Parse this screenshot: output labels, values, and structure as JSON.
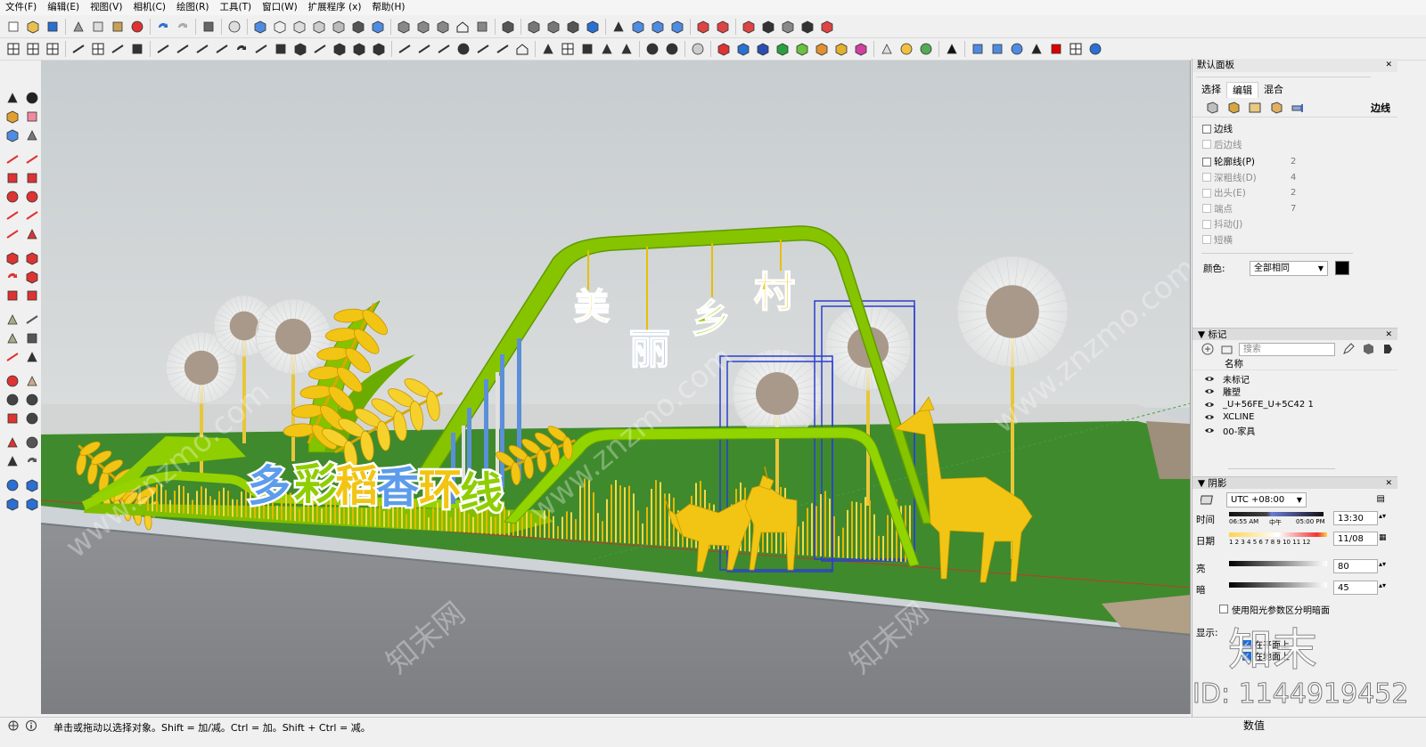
{
  "menu": [
    "文件(F)",
    "编辑(E)",
    "视图(V)",
    "相机(C)",
    "绘图(R)",
    "工具(T)",
    "窗口(W)",
    "扩展程序 (x)",
    "帮助(H)"
  ],
  "scene": {
    "title_chars": [
      "多",
      "彩",
      "稻",
      "香",
      "环",
      "线"
    ],
    "sign_chars": [
      "美",
      "丽",
      "乡",
      "村"
    ]
  },
  "panel": {
    "title": "默认面板",
    "tabs": [
      "选择",
      "编辑",
      "混合"
    ],
    "active_tab": "编辑",
    "edges_label": "边线",
    "edge_settings": [
      {
        "label": "边线",
        "checked": false,
        "disabled": false,
        "value": ""
      },
      {
        "label": "后边线",
        "checked": false,
        "disabled": true,
        "value": ""
      },
      {
        "label": "轮廓线(P)",
        "checked": false,
        "disabled": false,
        "value": "2"
      },
      {
        "label": "深粗线(D)",
        "checked": false,
        "disabled": true,
        "value": "4"
      },
      {
        "label": "出头(E)",
        "checked": false,
        "disabled": true,
        "value": "2"
      },
      {
        "label": "端点",
        "checked": false,
        "disabled": true,
        "value": "7"
      },
      {
        "label": "抖动(J)",
        "checked": false,
        "disabled": true,
        "value": ""
      },
      {
        "label": "短横",
        "checked": false,
        "disabled": true,
        "value": ""
      }
    ],
    "color_label": "颜色:",
    "color_value": "全部相同",
    "color_swatch": "#000000",
    "tags": {
      "title": "标记",
      "search_placeholder": "搜索",
      "col_name": "名称",
      "items": [
        "未标记",
        "雕塑",
        "_U+56FE_U+5C42 1",
        "XCLINE",
        "00-家具"
      ]
    },
    "shadows": {
      "title": "阴影",
      "timezone": "UTC +08:00",
      "time_label": "时间",
      "time_ticks": [
        "06:55 AM",
        "中午",
        "05:00 PM"
      ],
      "time_value": "13:30",
      "date_label": "日期",
      "date_ticks": "1 2 3 4 5 6 7 8 9 10 11 12",
      "date_value": "11/08",
      "light_label": "亮",
      "light_value": "80",
      "dark_label": "暗",
      "dark_value": "45",
      "sun_shading_text": "使用阳光参数区分明暗面",
      "display_label": "显示:",
      "display_opts": [
        "在平面上",
        "在地面上"
      ]
    }
  },
  "status": {
    "hint": "单击或拖动以选择对象。Shift = 加/减。Ctrl = 加。Shift + Ctrl = 减。",
    "vcb_label": "数值"
  },
  "watermark": {
    "site": "www.znzmo.com",
    "brand": "知末网",
    "id_text": "ID: 1144919452",
    "logo": "知末"
  },
  "colors": {
    "grass": "#3f8a2c",
    "lime": "#8fce00",
    "gold": "#f2c514",
    "road": "#8a8a8c",
    "sky": "#cfd5d8"
  }
}
